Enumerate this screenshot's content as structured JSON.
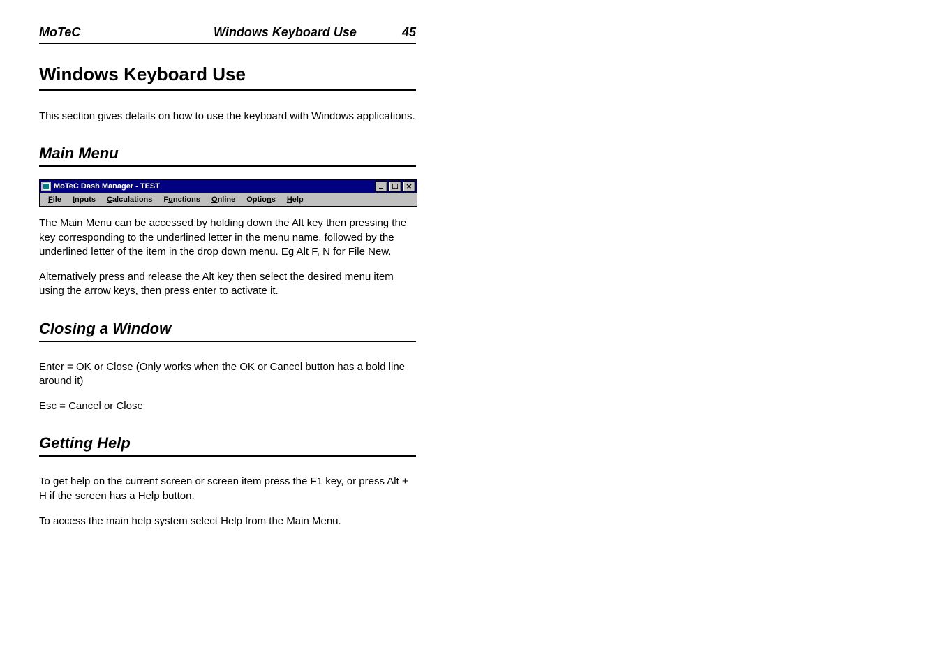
{
  "header": {
    "brand": "MoTeC",
    "section": "Windows Keyboard Use",
    "page_number": "45"
  },
  "title": "Windows Keyboard Use",
  "intro_paragraph": "This section gives details on how to use the keyboard with Windows applications.",
  "sections": {
    "main_menu": {
      "heading": "Main Menu",
      "screenshot": {
        "title": "MoTeC Dash Manager - TEST",
        "menu_items": [
          {
            "pre": "",
            "ul": "F",
            "post": "ile"
          },
          {
            "pre": "",
            "ul": "I",
            "post": "nputs"
          },
          {
            "pre": "",
            "ul": "C",
            "post": "alculations"
          },
          {
            "pre": "F",
            "ul": "u",
            "post": "nctions"
          },
          {
            "pre": "",
            "ul": "O",
            "post": "nline"
          },
          {
            "pre": "Optio",
            "ul": "n",
            "post": "s"
          },
          {
            "pre": "",
            "ul": "H",
            "post": "elp"
          }
        ]
      },
      "paragraph1_pre": "The Main Menu can be accessed by holding down the Alt key then pressing the key corresponding to the underlined letter in the menu name, followed by the underlined letter of the item in the drop down menu. Eg Alt F, N for ",
      "paragraph1_f_ul": "F",
      "paragraph1_f_rest": "ile ",
      "paragraph1_n_ul": "N",
      "paragraph1_n_rest": "ew.",
      "paragraph2": "Alternatively press and release the Alt key then select the desired menu item using the arrow keys, then press enter to activate it."
    },
    "closing": {
      "heading": "Closing a Window",
      "line1": "Enter = OK or Close (Only works when the OK or Cancel button has a bold line around it)",
      "line2": "Esc = Cancel or Close"
    },
    "help": {
      "heading": "Getting Help",
      "line1": "To get help on the current screen or screen item press the F1 key, or press Alt + H if the screen has a Help button.",
      "line2": "To access the main help system select Help from the Main Menu."
    }
  }
}
